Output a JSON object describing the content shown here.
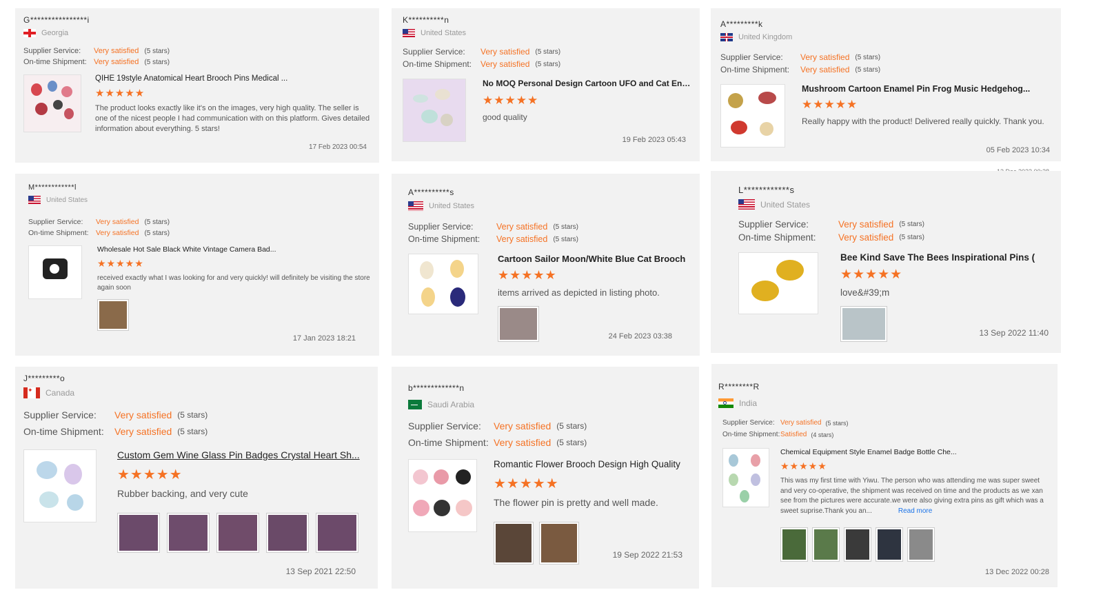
{
  "labels": {
    "supplier_service": "Supplier Service:",
    "ontime_shipment": "On-time Shipment:",
    "read_more": "Read more"
  },
  "colors": {
    "accent": "#f57224",
    "card_bg": "#f2f2f2",
    "link": "#1a73e8"
  },
  "floating_date": "13 Dec 2022 00:28",
  "reviews": [
    {
      "reviewer": "G****************i",
      "country": "Georgia",
      "flag": "ge",
      "supplier_value": "Very satisfied",
      "supplier_stars": "(5 stars)",
      "shipment_value": "Very satisfied",
      "shipment_stars": "(5 stars)",
      "product_title": "QIHE 19style Anatomical Heart Brooch Pins Medical ...",
      "stars": "★★★★★",
      "rating": 5,
      "text": "The product looks exactly like it's on the images, very high quality. The seller is one of the nicest people I had communication with on this platform. Gives detailed information about everything. 5 stars!",
      "date": "17 Feb 2023 00:54"
    },
    {
      "reviewer": "K**********n",
      "country": "United States",
      "flag": "us",
      "supplier_value": "Very satisfied",
      "supplier_stars": "(5 stars)",
      "shipment_value": "Very satisfied",
      "shipment_stars": "(5 stars)",
      "product_title": "No MOQ Personal Design Cartoon UFO and Cat Enam...",
      "stars": "★★★★★",
      "rating": 5,
      "text": "good quality",
      "date": "19 Feb 2023 05:43"
    },
    {
      "reviewer": "A*********k",
      "country": "United Kingdom",
      "flag": "uk",
      "supplier_value": "Very satisfied",
      "supplier_stars": "(5 stars)",
      "shipment_value": "Very satisfied",
      "shipment_stars": "(5 stars)",
      "product_title": "Mushroom Cartoon Enamel Pin Frog Music Hedgehog...",
      "stars": "★★★★★",
      "rating": 5,
      "text": "Really happy with the product! Delivered really quickly. Thank you.",
      "date": "05 Feb 2023 10:34"
    },
    {
      "reviewer": "M************l",
      "country": "United States",
      "flag": "us",
      "supplier_value": "Very satisfied",
      "supplier_stars": "(5 stars)",
      "shipment_value": "Very satisfied",
      "shipment_stars": "(5 stars)",
      "product_title": "Wholesale Hot Sale Black White Vintage Camera Bad...",
      "stars": "★★★★★",
      "rating": 5,
      "text": "received exactly what I was looking for and  very quickly! will definitely be visiting the store again soon",
      "date": "17 Jan 2023 18:21"
    },
    {
      "reviewer": "A**********s",
      "country": "United States",
      "flag": "us",
      "supplier_value": "Very satisfied",
      "supplier_stars": "(5 stars)",
      "shipment_value": "Very satisfied",
      "shipment_stars": "(5 stars)",
      "product_title": "Cartoon Sailor Moon/White Blue Cat Brooch",
      "stars": "★★★★★",
      "rating": 5,
      "text": "items arrived as depicted in listing photo.",
      "date": "24 Feb 2023 03:38"
    },
    {
      "reviewer": "L************s",
      "country": "United States",
      "flag": "us",
      "supplier_value": "Very satisfied",
      "supplier_stars": "(5 stars)",
      "shipment_value": "Very satisfied",
      "shipment_stars": "(5 stars)",
      "product_title": "Bee Kind Save The Bees Inspirational Pins (",
      "stars": "★★★★★",
      "rating": 5,
      "text": "love&#39;m",
      "date": "13 Sep 2022 11:40"
    },
    {
      "reviewer": "J*********o",
      "country": "Canada",
      "flag": "ca",
      "supplier_value": "Very satisfied",
      "supplier_stars": "(5 stars)",
      "shipment_value": "Very satisfied",
      "shipment_stars": "(5 stars)",
      "product_title": "Custom Gem Wine Glass Pin Badges Crystal Heart Sh...",
      "stars": "★★★★★",
      "rating": 5,
      "text": "Rubber backing, and very cute",
      "date": "13 Sep 2021 22:50"
    },
    {
      "reviewer": "b*************n",
      "country": "Saudi Arabia",
      "flag": "sa",
      "supplier_value": "Very satisfied",
      "supplier_stars": "(5 stars)",
      "shipment_value": "Very satisfied",
      "shipment_stars": "(5 stars)",
      "product_title": "Romantic Flower Brooch Design High Quality",
      "stars": "★★★★★",
      "rating": 5,
      "text": "The flower pin is pretty and well made.",
      "date": "19 Sep 2022 21:53"
    },
    {
      "reviewer": "R********R",
      "country": "India",
      "flag": "in",
      "supplier_value": "Very satisfied",
      "supplier_stars": "(5 stars)",
      "shipment_value": "Satisfied",
      "shipment_stars": "(4 stars)",
      "product_title": "Chemical Equipment Style Enamel Badge Bottle Che...",
      "stars": "★★★★★",
      "rating": 5,
      "text": "This was my first time with Yiwu. The person who was attending me was super sweet and very co-operative, the shipment was received on time and the products as we xan see from the pictures were accurate.we were also giving extra pins as gift which was a sweet suprise.Thank you an...",
      "date": "13 Dec 2022 00:28"
    }
  ]
}
